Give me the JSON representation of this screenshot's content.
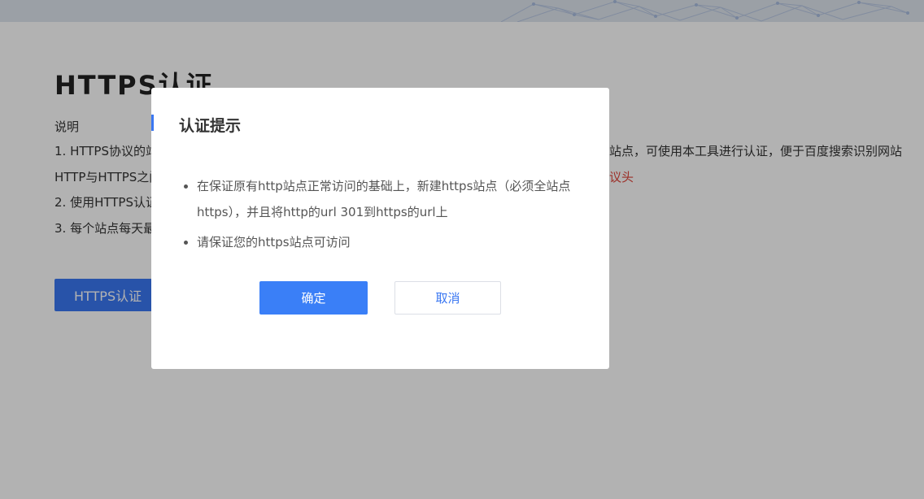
{
  "page": {
    "title": "HTTPS认证",
    "section_label": "说明",
    "notes": [
      {
        "left": "1. HTTPS协议的站",
        "right": "站点，可使用本工具进行认证，便于百度搜索识别网站"
      },
      {
        "left": "HTTP与HTTPS之门",
        "right_red": "议头"
      },
      {
        "left": "2. 使用HTTPS认证"
      },
      {
        "left": "3. 每个站点每天最"
      }
    ],
    "main_button_label": "HTTPS认证"
  },
  "modal": {
    "title": "认证提示",
    "items": [
      "在保证原有http站点正常访问的基础上，新建https站点（必须全站点https），并且将http的url 301到https的url上",
      "请保证您的https站点可访问"
    ],
    "confirm_label": "确定",
    "cancel_label": "取消"
  },
  "colors": {
    "accent": "#3a77f2",
    "warning_text": "#e0443a",
    "overlay": "rgba(0,0,0,0.30)"
  }
}
